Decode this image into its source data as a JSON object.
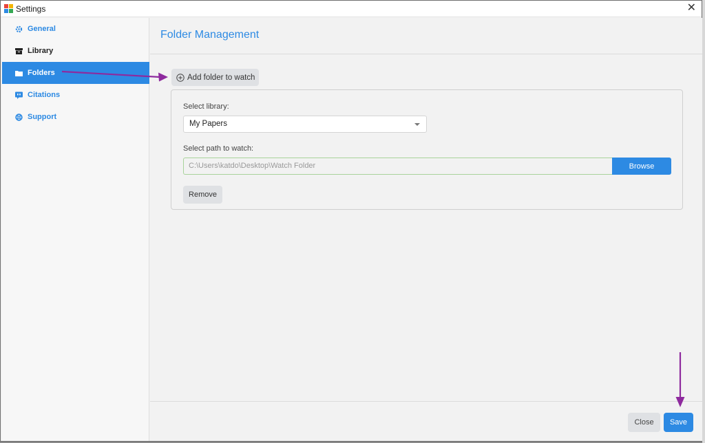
{
  "window": {
    "title": "Settings",
    "close_glyph": "✕"
  },
  "sidebar": {
    "items": [
      {
        "label": "General",
        "icon": "gear-icon"
      },
      {
        "label": "Library",
        "icon": "archive-icon"
      },
      {
        "label": "Folders",
        "icon": "folder-icon",
        "active": true
      },
      {
        "label": "Citations",
        "icon": "quote-icon"
      },
      {
        "label": "Support",
        "icon": "lifebuoy-icon"
      }
    ]
  },
  "main": {
    "title": "Folder Management",
    "add_folder_label": "Add folder to watch",
    "select_library_label": "Select library:",
    "library_value": "My Papers",
    "select_path_label": "Select path to watch:",
    "path_value": "C:\\Users\\katdo\\Desktop\\Watch Folder",
    "browse_label": "Browse",
    "remove_label": "Remove"
  },
  "footer": {
    "close_label": "Close",
    "save_label": "Save"
  },
  "colors": {
    "accent": "#2d8ae3",
    "annotation_arrow": "#8e2a9e"
  }
}
